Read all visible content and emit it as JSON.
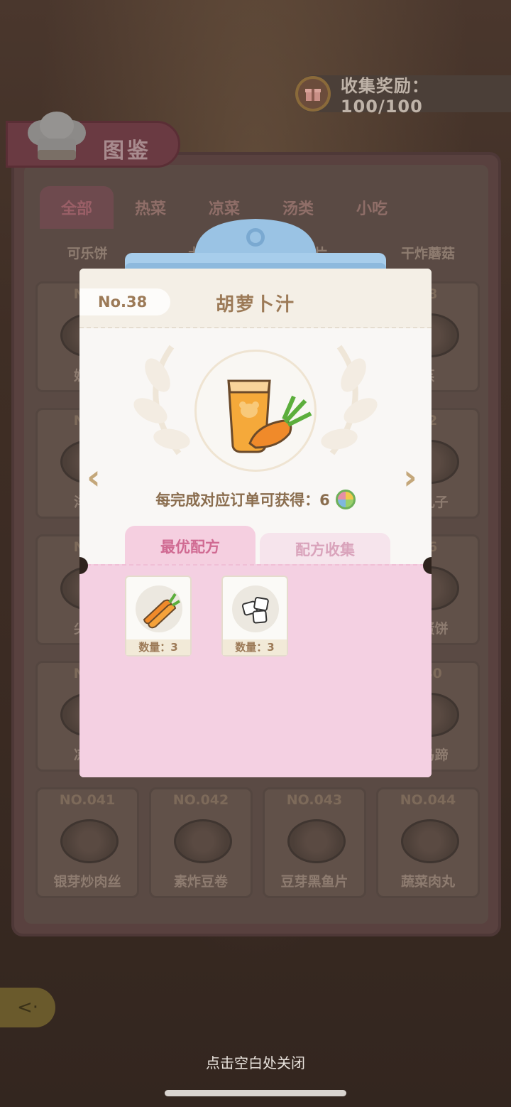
{
  "top_bar": {
    "reward_label": "收集奖励：100/100",
    "reward_icon": "gift-box-icon"
  },
  "book": {
    "title": "图鉴",
    "tabs": [
      "全部",
      "热菜",
      "凉菜",
      "汤类",
      "小吃"
    ],
    "row_top_names": [
      "可乐饼",
      "土豆",
      "肉片",
      "干炸蘑菇"
    ],
    "cards": [
      {
        "no": "NO.",
        "name": "奶油"
      },
      {
        "no": "28",
        "name": "蒸"
      },
      {
        "no": "NO.",
        "name": "洋葱"
      },
      {
        "no": "32",
        "name": "腐丸子"
      },
      {
        "no": "NO.",
        "name": "尖椒"
      },
      {
        "no": "36",
        "name": "鸡蛋饼"
      },
      {
        "no": "NO.",
        "name": "凉拌"
      },
      {
        "no": "040",
        "name": "药马蹄"
      },
      {
        "no": "NO.041",
        "name": "银芽炒肉丝"
      },
      {
        "no": "NO.042",
        "name": "素炸豆卷"
      },
      {
        "no": "NO.043",
        "name": "豆芽黑鱼片"
      },
      {
        "no": "NO.044",
        "name": "蔬菜肉丸"
      }
    ]
  },
  "modal": {
    "number": "No.38",
    "title": "胡萝卜汁",
    "reward_text": "每完成对应订单可获得：6",
    "tabs": {
      "best": "最优配方",
      "collect": "配方收集"
    },
    "ingredients": [
      {
        "icon": "carrot-icon",
        "qty": "数量：3"
      },
      {
        "icon": "ice-cube-icon",
        "qty": "数量：3"
      }
    ]
  },
  "close_hint": "点击空白处关闭"
}
